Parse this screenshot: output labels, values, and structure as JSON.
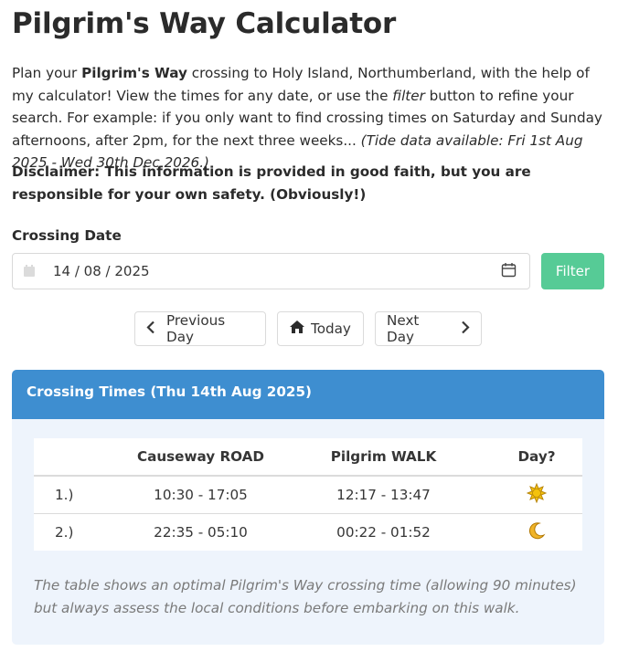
{
  "page": {
    "title": "Pilgrim's Way Calculator",
    "intro": {
      "p1": "Plan your ",
      "b1": "Pilgrim's Way",
      "p2": " crossing to Holy Island, Northumberland, with the help of my calculator! View the times for any date, or use the ",
      "i1": "filter",
      "p3": " button to refine your search. For example: if you only want to find crossing times on Saturday and Sunday afternoons, after 2pm, for the next three weeks... ",
      "i2": "(Tide data available: Fri 1st Aug 2025 - Wed 30th Dec 2026.)"
    },
    "disclaimer": "Disclaimer: This information is provided in good faith, but you are responsible for your own safety. (Obviously!)"
  },
  "date_picker": {
    "label": "Crossing Date",
    "value": "14 / 08 / 2025",
    "filter_label": "Filter"
  },
  "nav": {
    "previous_label": "Previous Day",
    "today_label": "Today",
    "next_label": "Next Day"
  },
  "crossing": {
    "heading": "Crossing Times (Thu 14th Aug 2025)",
    "columns": [
      "",
      "Causeway ROAD",
      "Pilgrim WALK",
      "Day?"
    ],
    "rows": [
      {
        "index": "1.)",
        "road": "10:30 - 17:05",
        "walk": "12:17 - 13:47",
        "day_icon": "sun-icon",
        "day_glyph": "☀"
      },
      {
        "index": "2.)",
        "road": "22:35 - 05:10",
        "walk": "00:22 - 01:52",
        "day_icon": "crescent-moon-icon",
        "day_glyph": "🌙"
      }
    ],
    "note": "The table shows an optimal Pilgrim's Way crossing time (allowing 90 minutes) but always assess the local conditions before embarking on this walk."
  },
  "colors": {
    "filter_button": "#48c78e",
    "panel_header": "#3e8ed0",
    "panel_body": "#eef4fc",
    "sun": "#f4c20d",
    "moon": "#f0b429"
  }
}
